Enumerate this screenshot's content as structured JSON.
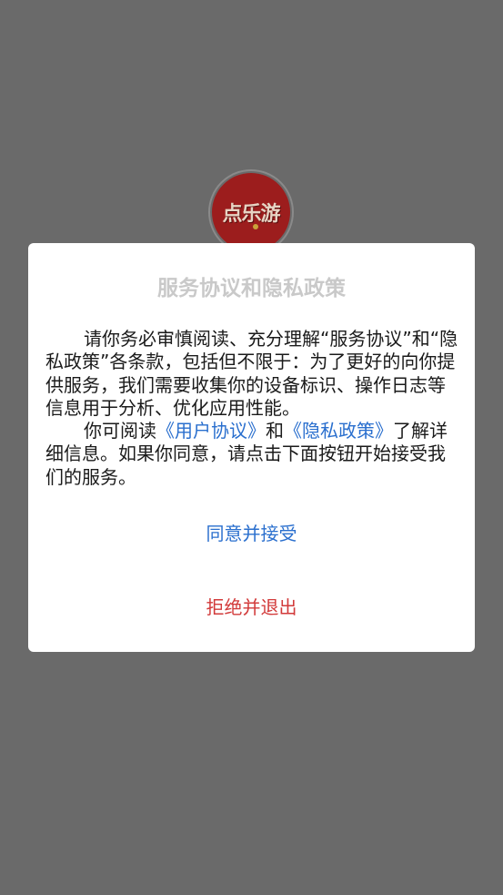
{
  "app": {
    "logo_text": "点乐游"
  },
  "dialog": {
    "title": "服务协议和隐私政策",
    "paragraph1": "请你务必审慎阅读、充分理解“服务协议”和“隐私政策”各条款，包括但不限于：为了更好的向你提供服务，我们需要收集你的设备标识、操作日志等信息用于分析、优化应用性能。",
    "paragraph2_prefix": "你可阅读",
    "user_agreement_link": "《用户协议》",
    "paragraph2_and": "和",
    "privacy_policy_link": "《隐私政策》",
    "paragraph2_suffix": "了解详细信息。如果你同意，请点击下面按钮开始接受我们的服务。",
    "accept_label": "同意并接受",
    "reject_label": "拒绝并退出"
  },
  "colors": {
    "overlay": "#6a6a6a",
    "link": "#2a6fce",
    "reject": "#d23a3a",
    "title": "#c9c9c9",
    "logo_bg": "#9c1d1d"
  }
}
